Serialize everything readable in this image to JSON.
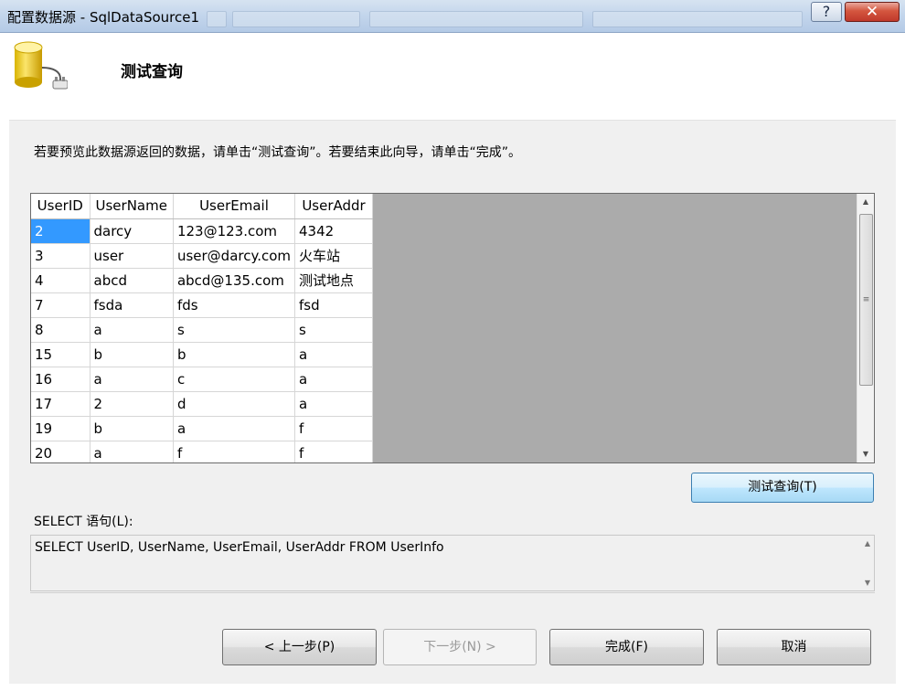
{
  "window": {
    "title": "配置数据源 - SqlDataSource1",
    "help_label": "?",
    "close_label": "✕"
  },
  "header": {
    "page_title": "测试查询",
    "icon": "database-plug-icon"
  },
  "instruction": "若要预览此数据源返回的数据，请单击“测试查询”。若要结束此向导，请单击“完成”。",
  "grid": {
    "columns": [
      "UserID",
      "UserName",
      "UserEmail",
      "UserAddr"
    ],
    "rows": [
      [
        "2",
        "darcy",
        "123@123.com",
        "4342"
      ],
      [
        "3",
        "user",
        "user@darcy.com",
        "火车站"
      ],
      [
        "4",
        "abcd",
        "abcd@135.com",
        "测试地点"
      ],
      [
        "7",
        "fsda",
        "fds",
        "fsd"
      ],
      [
        "8",
        "a",
        "s",
        "s"
      ],
      [
        "15",
        "b",
        "b",
        "a"
      ],
      [
        "16",
        "a",
        "c",
        "a"
      ],
      [
        "17",
        "2",
        "d",
        "a"
      ],
      [
        "19",
        "b",
        "a",
        "f"
      ],
      [
        "20",
        "a",
        "f",
        "f"
      ]
    ]
  },
  "test_button": "测试查询(T)",
  "sql": {
    "label": "SELECT 语句(L):",
    "value": "SELECT UserID, UserName, UserEmail, UserAddr FROM UserInfo"
  },
  "buttons": {
    "back": "< 上一步(P)",
    "next": "下一步(N) >",
    "finish": "完成(F)",
    "cancel": "取消"
  },
  "colors": {
    "selection": "#3399ff",
    "grid_background": "#ababab",
    "dialog_background": "#f0f0f0"
  }
}
